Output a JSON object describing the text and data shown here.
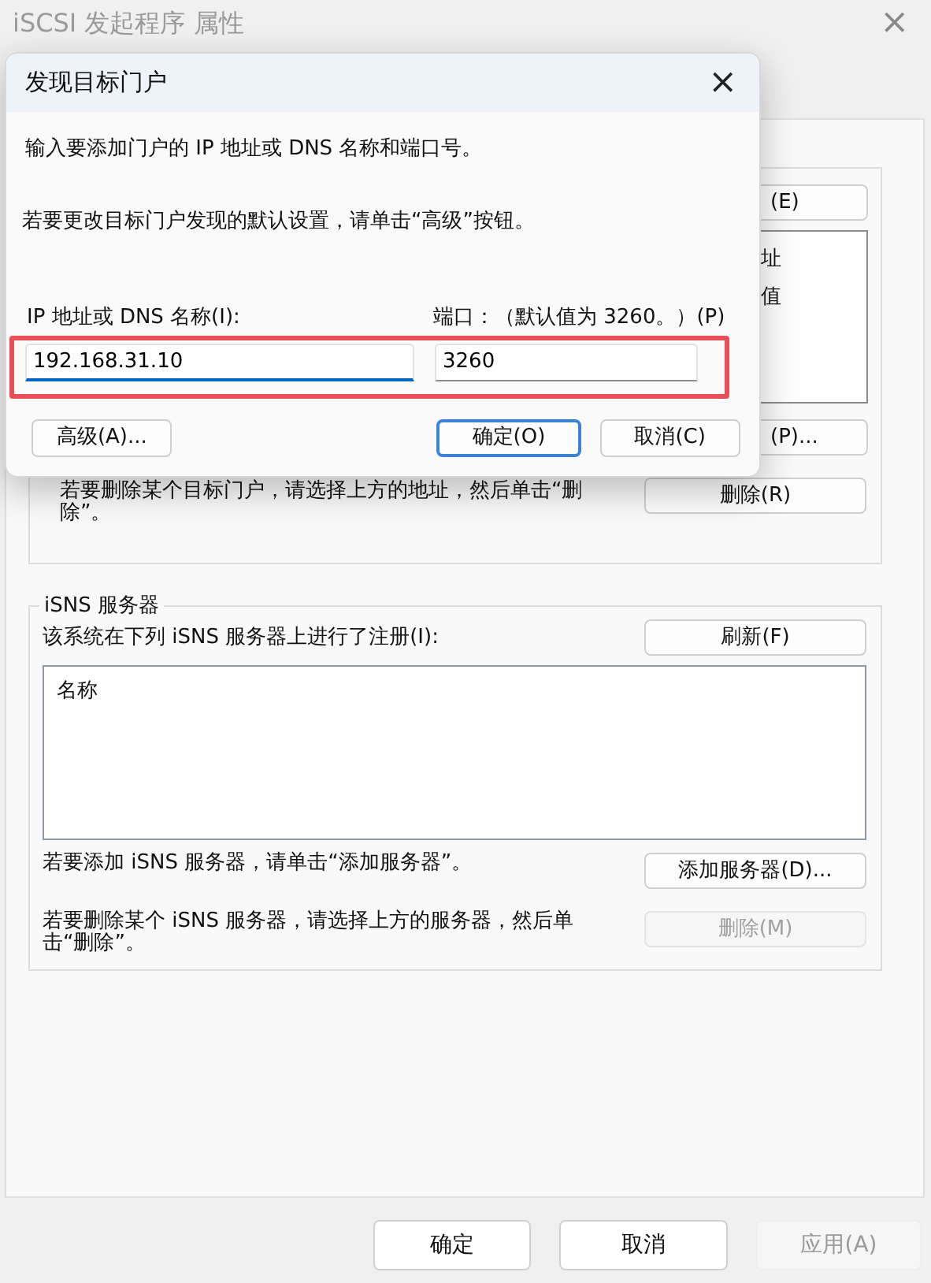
{
  "window": {
    "title": "iSCSI 发起程序 属性",
    "close_glyph": "×"
  },
  "targets_group": {
    "fragment_button_1": "(E)",
    "fragment_list_lines": [
      "址",
      "值"
    ],
    "fragment_button_2": "(P)...",
    "remove_hint": "若要删除某个目标门户，请选择上方的地址，然后单击“删除”。",
    "remove_button": "删除(R)"
  },
  "isns_group": {
    "title": "iSNS 服务器",
    "registered_label": "该系统在下列 iSNS 服务器上进行了注册(I):",
    "refresh_button": "刷新(F)",
    "list_columns": [
      "名称"
    ],
    "actions": [
      {
        "hint": "若要添加 iSNS 服务器，请单击“添加服务器”。",
        "button": "添加服务器(D)...",
        "disabled": false
      },
      {
        "hint": "若要删除某个 iSNS 服务器，请选择上方的服务器，然后单击“删除”。",
        "button": "删除(M)",
        "disabled": true
      }
    ]
  },
  "footer_buttons": [
    {
      "label": "确定",
      "disabled": false
    },
    {
      "label": "取消",
      "disabled": false
    },
    {
      "label": "应用(A)",
      "disabled": true
    }
  ],
  "dialog": {
    "title": "发现目标门户",
    "close_glyph": "×",
    "intro": "输入要添加门户的 IP 地址或 DNS 名称和端口号。",
    "advanced_hint": "若要更改目标门户发现的默认设置，请单击“高级”按钮。",
    "address": {
      "label": "IP 地址或 DNS 名称(I):",
      "value": "192.168.31.10",
      "focused": true
    },
    "port": {
      "label": "端口：（默认值为 3260。）(P)",
      "value": "3260",
      "focused": false
    },
    "highlighted": true,
    "buttons": [
      {
        "label": "高级(A)...",
        "default": false
      },
      {
        "label": "确定(O)",
        "default": true
      },
      {
        "label": "取消(C)",
        "default": false
      }
    ]
  }
}
